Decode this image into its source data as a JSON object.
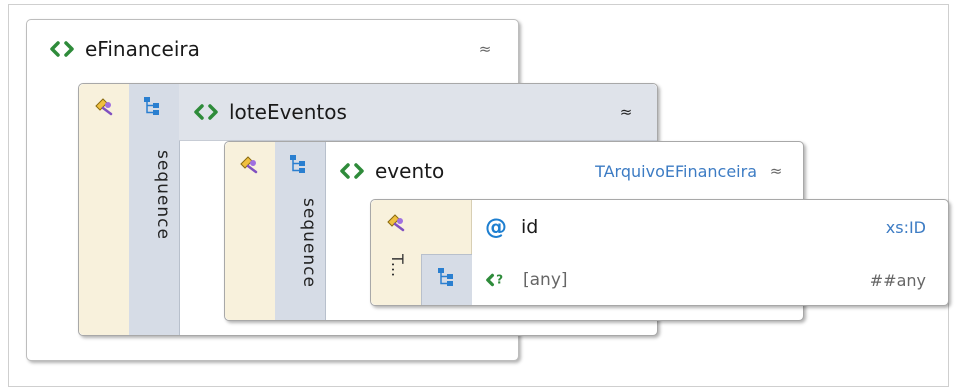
{
  "elements": {
    "root": {
      "name": "eFinanceira",
      "collapse": "≈"
    },
    "lote": {
      "name": "loteEventos",
      "compositor": "sequence",
      "collapse": "≈"
    },
    "evento": {
      "name": "evento",
      "type": "TArquivoEFinanceira",
      "compositor": "sequence",
      "collapse": "≈"
    },
    "inner": {
      "annotation_short": "T...",
      "attribute": {
        "symbol": "@",
        "name": "id",
        "type": "xs:ID"
      },
      "wildcard": {
        "name": "[any]",
        "namespace": "##any"
      }
    }
  },
  "colors": {
    "element_icon": "#2e8b3a",
    "annotation_bg": "#f8f1dc",
    "sequence_bg": "#d6dce6",
    "type_text": "#3d7cc4",
    "attribute_symbol": "#1e7fd0"
  },
  "icons": [
    "element-icon",
    "annotation-pin-icon",
    "sequence-tree-icon",
    "attribute-icon",
    "wildcard-icon",
    "collapse-icon"
  ]
}
